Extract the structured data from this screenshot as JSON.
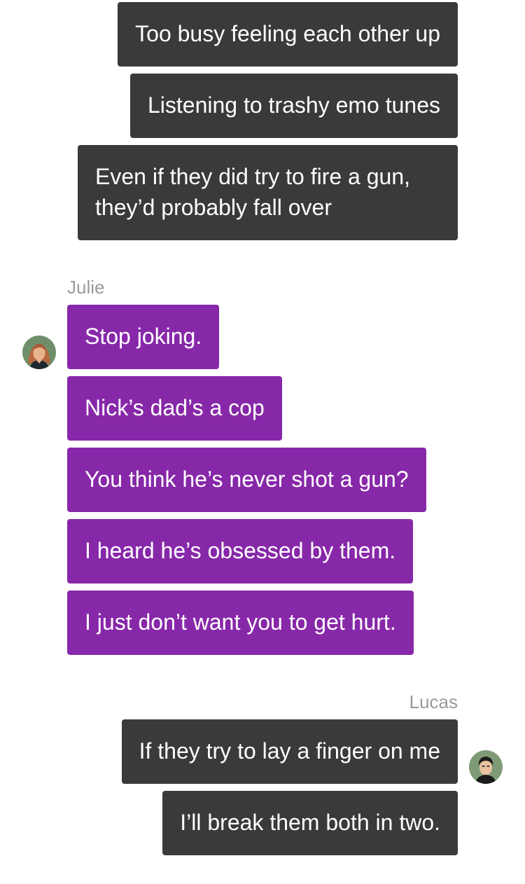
{
  "conversation": {
    "group1": {
      "messages": [
        {
          "text": "Too busy feeling each other up"
        },
        {
          "text": "Listening to trashy emo tunes"
        },
        {
          "text": "Even if they did try to fire a gun, they’d probably fall over"
        }
      ]
    },
    "group2": {
      "sender": "Julie",
      "avatar": "julie-avatar-icon",
      "bubble_color": "#8728a9",
      "messages": [
        {
          "text": "Stop joking."
        },
        {
          "text": "Nick’s dad’s a cop"
        },
        {
          "text": "You think he’s never shot a gun?"
        },
        {
          "text": "I heard he’s obsessed by them."
        },
        {
          "text": "I just don’t want you to get hurt."
        }
      ]
    },
    "group3": {
      "sender": "Lucas",
      "avatar": "lucas-avatar-icon",
      "bubble_color": "#3a3a3a",
      "messages": [
        {
          "text": "If they try to lay a finger on me"
        },
        {
          "text": "I’ll break them both in two."
        }
      ]
    }
  }
}
